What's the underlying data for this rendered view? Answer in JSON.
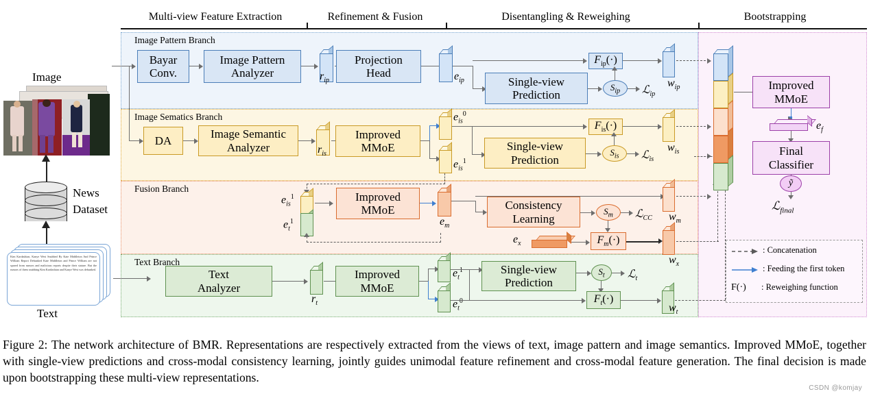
{
  "figure": {
    "caption": "Figure 2: The network architecture of BMR. Representations are respectively extracted from the views of text, image pattern and image semantics. Improved MMoE, together with single-view predictions and cross-modal consistency learning, jointly guides unimodal feature refinement and cross-modal feature generation. The final decision is made upon bootstrapping these multi-view representations.",
    "watermark": "CSDN @komjay"
  },
  "phases": [
    {
      "label": "Multi-view Feature Extraction"
    },
    {
      "label": "Refinement & Fusion"
    },
    {
      "label": "Disentangling & Reweighing"
    },
    {
      "label": "Bootstrapping"
    }
  ],
  "inputs": {
    "image_label": "Image",
    "dataset_label_line1": "News",
    "dataset_label_line2": "Dataset",
    "text_label": "Text",
    "text_sample": "Kim Kardashian, Kanye West Snubbed By Kate Middleton And Prince William Report Debunked Kate Middleton and Prince William are not spared from rumors and malicious reports despite their stature. But the rumors of them snubbing Kim Kardashian and Kanye West was debunked."
  },
  "branches": {
    "image_pattern": {
      "title": "Image Pattern Branch",
      "box_bayar": "Bayar\nConv.",
      "box_analyzer": "Image Pattern\nAnalyzer",
      "box_projection": "Projection\nHead",
      "box_prediction": "Single-view\nPrediction",
      "token_r": "r",
      "token_r_sub": "ip",
      "token_e": "e",
      "token_e_sub": "ip",
      "fbox": "F",
      "fbox_sub": "ip",
      "fbox_tail": "(·)",
      "ellipse": "S",
      "ellipse_sub": "ip",
      "loss": "ℒ",
      "loss_sub": "ip",
      "weight": "w",
      "weight_sub": "ip",
      "color": "#4b7eb8"
    },
    "image_semantics": {
      "title": "Image Sematics Branch",
      "box_da": "DA",
      "box_analyzer": "Image Semantic\nAnalyzer",
      "box_mmoe": "Improved\nMMoE",
      "box_prediction": "Single-view\nPrediction",
      "token_r": "r",
      "token_r_sub": "is",
      "token_e0": "e",
      "token_e0_sub": "is",
      "token_e0_sup": "0",
      "token_e1": "e",
      "token_e1_sub": "is",
      "token_e1_sup": "1",
      "fbox": "F",
      "fbox_sub": "is",
      "fbox_tail": "(·)",
      "ellipse": "S",
      "ellipse_sub": "is",
      "loss": "ℒ",
      "loss_sub": "is",
      "weight": "w",
      "weight_sub": "is",
      "color": "#c99a25"
    },
    "fusion": {
      "title": "Fusion Branch",
      "box_mmoe": "Improved\nMMoE",
      "box_consistency": "Consistency\nLearning",
      "in_top": "e",
      "in_top_sub": "is",
      "in_top_sup": "1",
      "in_bot": "e",
      "in_bot_sub": "t",
      "in_bot_sup": "1",
      "token_em": "e",
      "token_em_sub": "m",
      "token_ex": "e",
      "token_ex_sub": "x",
      "fbox": "F",
      "fbox_sub": "m",
      "fbox_tail": "(·)",
      "ellipse": "S",
      "ellipse_sub": "m",
      "loss": "ℒ",
      "loss_sub": "CC",
      "weight_m": "w",
      "weight_m_sub": "m",
      "weight_x": "w",
      "weight_x_sub": "x",
      "color": "#da6c2e"
    },
    "text": {
      "title": "Text Branch",
      "box_analyzer": "Text\nAnalyzer",
      "box_mmoe": "Improved\nMMoE",
      "box_prediction": "Single-view\nPrediction",
      "token_r": "r",
      "token_r_sub": "t",
      "token_e1": "e",
      "token_e1_sub": "t",
      "token_e1_sup": "1",
      "token_e0": "e",
      "token_e0_sub": "t",
      "token_e0_sup": "0",
      "fbox": "F",
      "fbox_sub": "t",
      "fbox_tail": "(·)",
      "ellipse": "S",
      "ellipse_sub": "t",
      "loss": "ℒ",
      "loss_sub": "t",
      "weight": "w",
      "weight_sub": "t",
      "color": "#5f9150"
    },
    "bootstrapping": {
      "box_mmoe": "Improved\nMMoE",
      "box_classifier": "Final\nClassifier",
      "token_ef": "e",
      "token_ef_sub": "f",
      "ellipse": "ỹ",
      "loss": "ℒ",
      "loss_sub": "final",
      "color": "#9c40a8",
      "stack_segments": [
        {
          "name": "w_ip",
          "color": "#d3e4f7",
          "border": "#4b7eb8"
        },
        {
          "name": "w_is",
          "color": "#fcefc2",
          "border": "#c99a25"
        },
        {
          "name": "w_m",
          "color": "#fce0cd",
          "border": "#da6c2e"
        },
        {
          "name": "w_x",
          "color": "#ef9a63",
          "border": "#da6c2e"
        },
        {
          "name": "w_t",
          "color": "#d6e9ce",
          "border": "#5f9150"
        }
      ]
    }
  },
  "legend": {
    "rows": [
      {
        "glyph": "dashed-arrow-icon",
        "text": ": Concatenation"
      },
      {
        "glyph": "blue-arrow-icon",
        "text": ": Feeding the first token"
      },
      {
        "glyph": "F(·)",
        "text": ": Reweighing function"
      }
    ]
  }
}
